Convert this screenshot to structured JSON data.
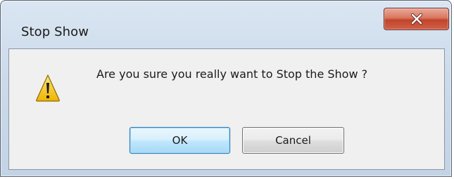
{
  "dialog": {
    "title": "Stop Show",
    "message": "Are you sure you really want to Stop the Show ?",
    "icon": "warning-icon",
    "close_icon": "close-icon",
    "buttons": {
      "ok_label": "OK",
      "cancel_label": "Cancel"
    }
  },
  "colors": {
    "close_button": "#c94f37",
    "ok_button_border": "#3c7fb1",
    "warning_fill": "#f6c925"
  }
}
